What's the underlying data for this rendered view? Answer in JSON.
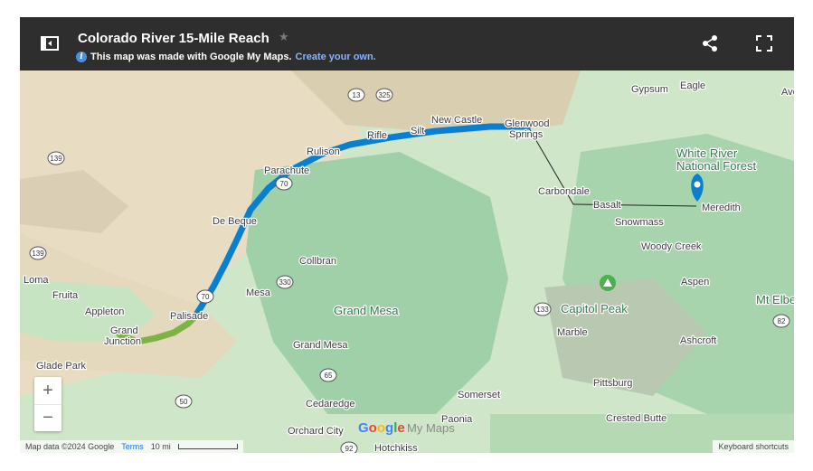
{
  "header": {
    "title": "Colorado River 15-Mile Reach",
    "subtitle_text": "This map was made with Google My Maps.",
    "subtitle_link": "Create your own."
  },
  "colors": {
    "header_bg": "#2e2e2e",
    "route_blue": "#0a7fcf",
    "route_green": "#7cb342",
    "marker_blue": "#0a7fcf",
    "marker_green": "#4caf50"
  },
  "icons": {
    "sidebar_toggle": "sidebar-toggle-icon",
    "star": "star-icon",
    "info": "info-icon",
    "share": "share-icon",
    "fullscreen": "fullscreen-icon",
    "marker": "map-marker-icon",
    "park": "park-marker-icon"
  },
  "places": [
    {
      "name": "Gypsum"
    },
    {
      "name": "Eagle"
    },
    {
      "name": "Avo"
    },
    {
      "name": "New Castle"
    },
    {
      "name": "Glenwood"
    },
    {
      "name": "Springs"
    },
    {
      "name": "Rifle"
    },
    {
      "name": "Silt"
    },
    {
      "name": "Rulison"
    },
    {
      "name": "Parachute"
    },
    {
      "name": "De Beque"
    },
    {
      "name": "White River"
    },
    {
      "name": "National Forest"
    },
    {
      "name": "Carbondale"
    },
    {
      "name": "Basalt"
    },
    {
      "name": "Meredith"
    },
    {
      "name": "Snowmass"
    },
    {
      "name": "Woody Creek"
    },
    {
      "name": "Aspen"
    },
    {
      "name": "Collbran"
    },
    {
      "name": "Loma"
    },
    {
      "name": "Fruita"
    },
    {
      "name": "Mesa"
    },
    {
      "name": "Appleton"
    },
    {
      "name": "Grand"
    },
    {
      "name": "Junction"
    },
    {
      "name": "Palisade"
    },
    {
      "name": "Grand Mesa"
    },
    {
      "name": "Grand Mesa"
    },
    {
      "name": "Capitol Peak"
    },
    {
      "name": "Mt Elbert"
    },
    {
      "name": "Marble"
    },
    {
      "name": "Ashcroft"
    },
    {
      "name": "Glade Park"
    },
    {
      "name": "Somerset"
    },
    {
      "name": "Pittsburg"
    },
    {
      "name": "Cedaredge"
    },
    {
      "name": "Crested Butte"
    },
    {
      "name": "Orchard City"
    },
    {
      "name": "Paonia"
    },
    {
      "name": "Hotchkiss"
    }
  ],
  "shields": [
    {
      "num": "13"
    },
    {
      "num": "325"
    },
    {
      "num": "139"
    },
    {
      "num": "139"
    },
    {
      "num": "70"
    },
    {
      "num": "330"
    },
    {
      "num": "70"
    },
    {
      "num": "133"
    },
    {
      "num": "82"
    },
    {
      "num": "65"
    },
    {
      "num": "50"
    },
    {
      "num": "92"
    }
  ],
  "controls": {
    "zoom_in": "+",
    "zoom_out": "−"
  },
  "footer": {
    "map_data": "Map data ©2024 Google",
    "terms": "Terms",
    "scale": "10 mi",
    "keyboard": "Keyboard shortcuts"
  },
  "branding": {
    "google": "Google",
    "mymaps": "My Maps"
  }
}
